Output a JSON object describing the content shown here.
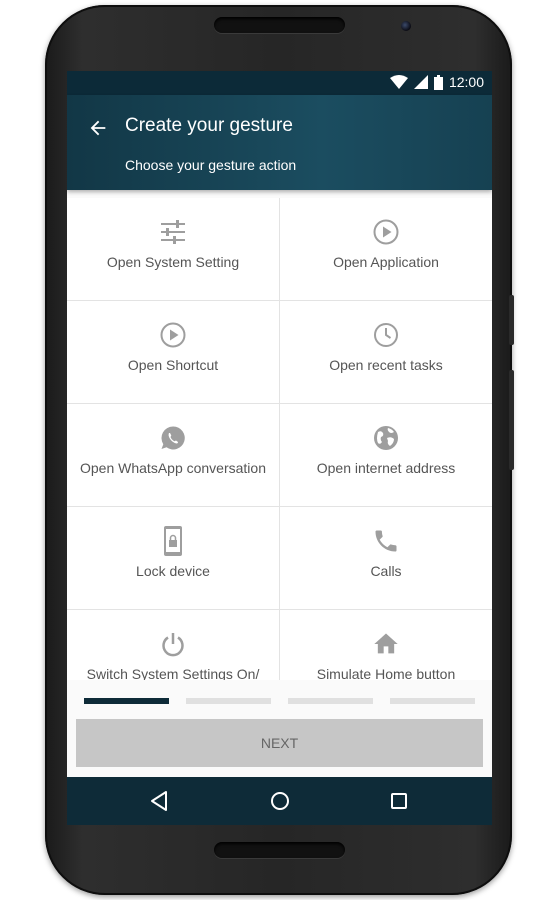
{
  "statusbar": {
    "time": "12:00",
    "icons": [
      "wifi-icon",
      "signal-icon",
      "battery-icon"
    ]
  },
  "appbar": {
    "title": "Create your gesture",
    "subtitle": "Choose your gesture action"
  },
  "actions": [
    {
      "label": "Open System Setting",
      "icon": "settings-sliders-icon"
    },
    {
      "label": "Open Application",
      "icon": "play-circle-icon"
    },
    {
      "label": "Open Shortcut",
      "icon": "play-circle-icon"
    },
    {
      "label": "Open recent tasks",
      "icon": "clock-icon"
    },
    {
      "label": "Open WhatsApp conversation",
      "icon": "whatsapp-icon"
    },
    {
      "label": "Open internet address",
      "icon": "globe-icon"
    },
    {
      "label": "Lock device",
      "icon": "phone-lock-icon"
    },
    {
      "label": "Calls",
      "icon": "phone-icon"
    },
    {
      "label": "Switch System Settings On/ Off",
      "icon": "power-icon"
    },
    {
      "label": "Simulate Home button",
      "icon": "home-icon"
    }
  ],
  "progress": {
    "steps": 4,
    "current": 1
  },
  "next_label": "NEXT",
  "navbar": {
    "icons": [
      "back-triangle-icon",
      "home-circle-icon",
      "recents-square-icon"
    ]
  },
  "colors": {
    "primary": "#123746",
    "active_step": "#0e2b38",
    "inactive_step": "#e0e0e0",
    "icon": "#9e9e9e"
  }
}
